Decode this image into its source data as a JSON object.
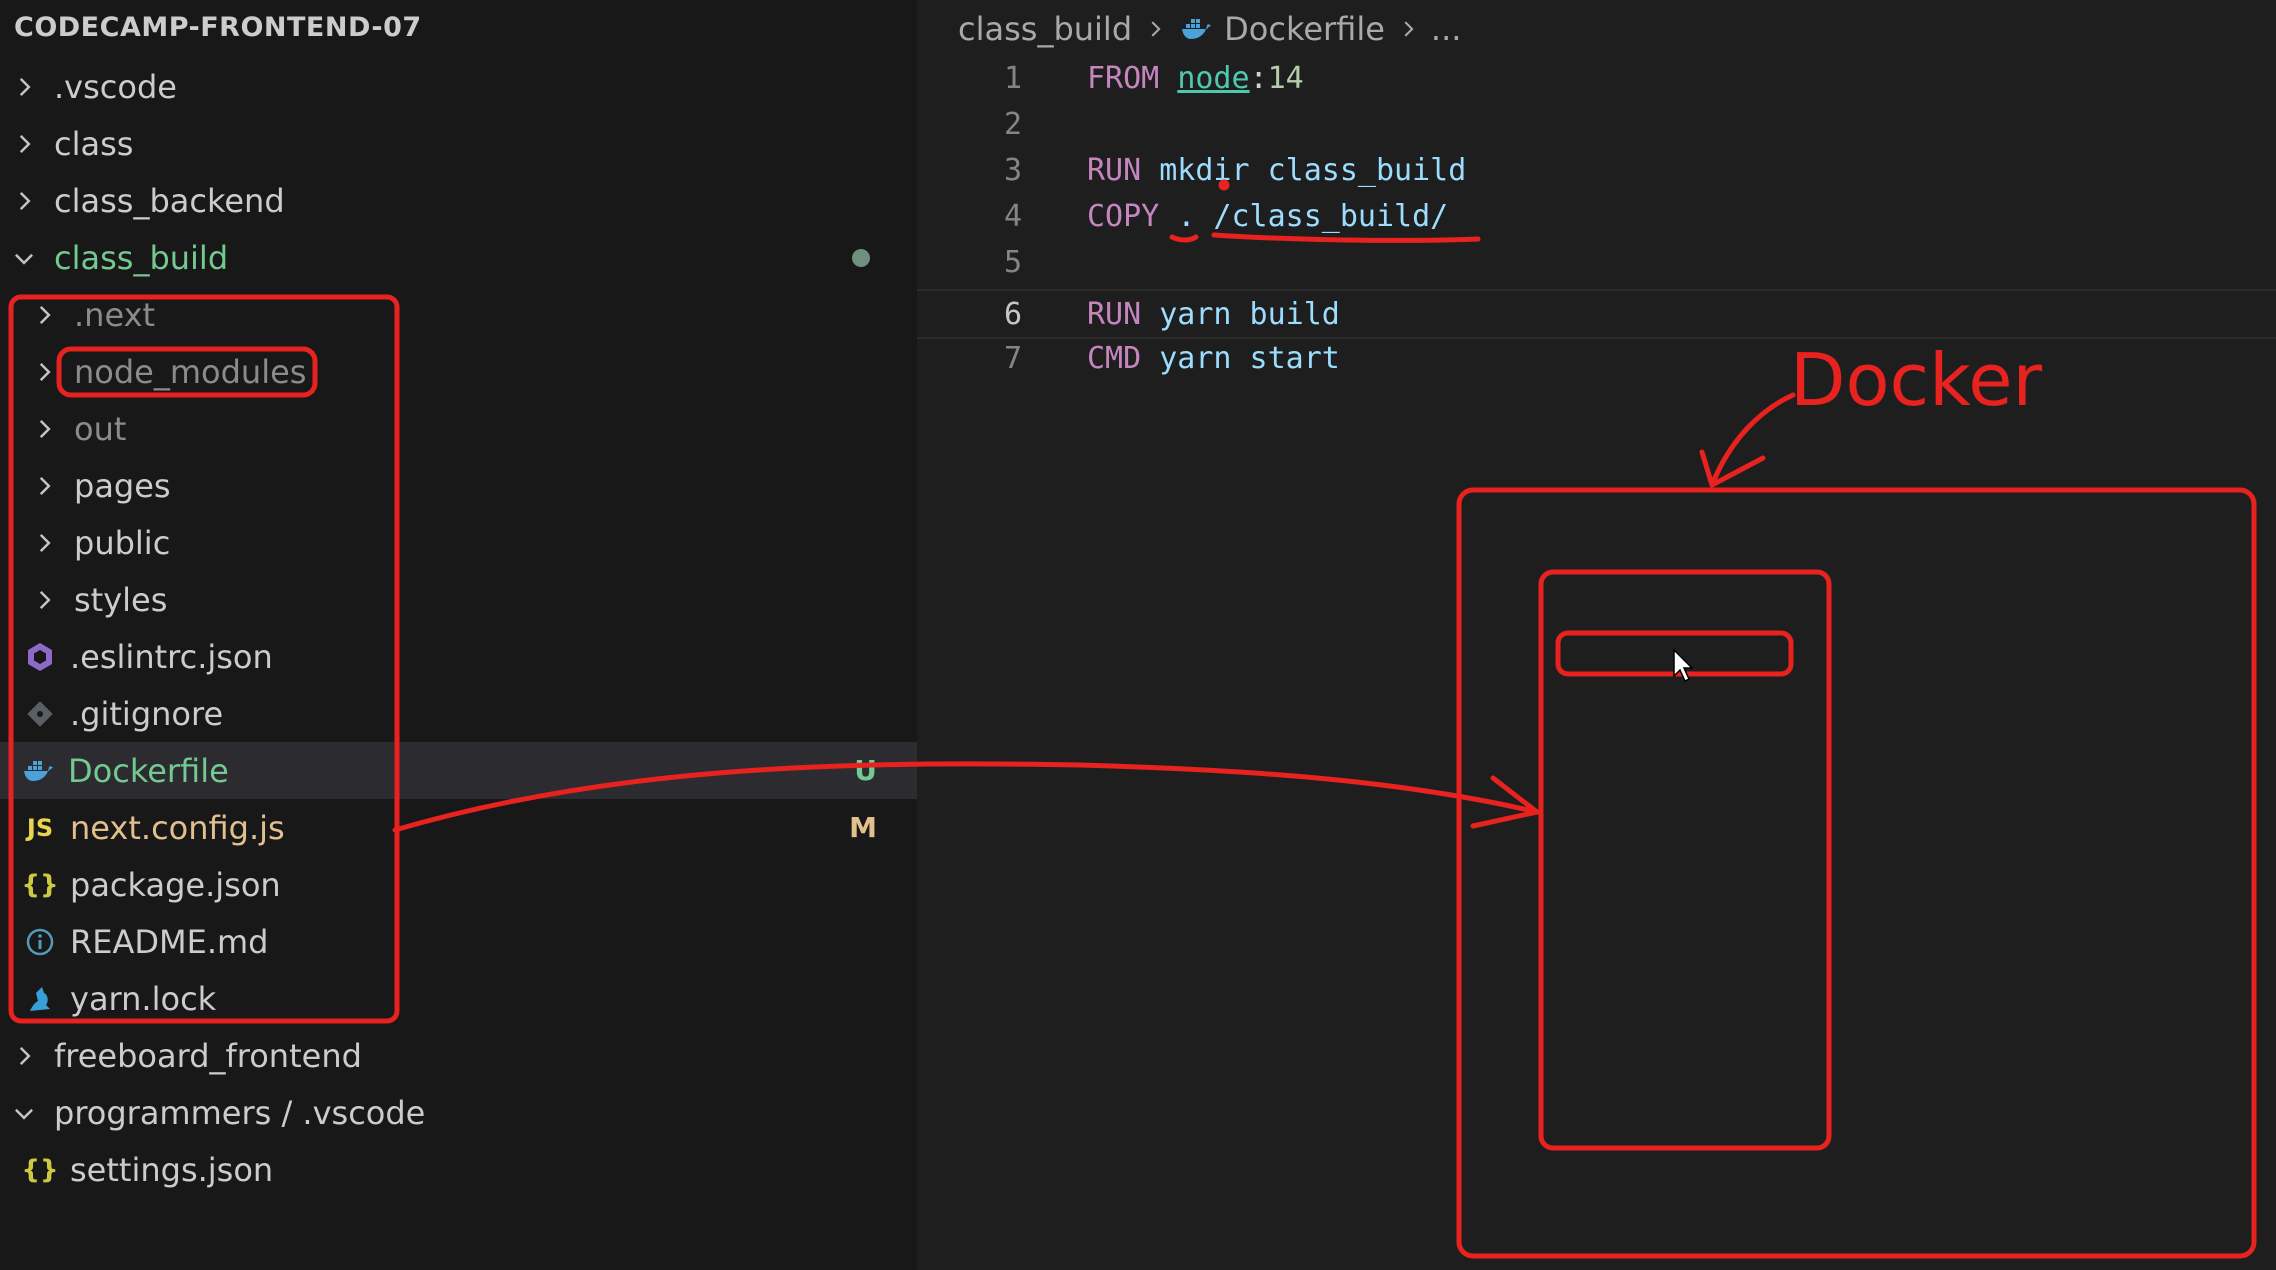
{
  "explorer": {
    "project_title": "CODECAMP-FRONTEND-07",
    "items": [
      {
        "label": ".vscode",
        "kind": "folder",
        "expanded": false,
        "depth": 0
      },
      {
        "label": "class",
        "kind": "folder",
        "expanded": false,
        "depth": 0
      },
      {
        "label": "class_backend",
        "kind": "folder",
        "expanded": false,
        "depth": 0
      },
      {
        "label": "class_build",
        "kind": "folder",
        "expanded": true,
        "depth": 0
      },
      {
        "label": ".next",
        "kind": "folder",
        "expanded": false,
        "depth": 1
      },
      {
        "label": "node_modules",
        "kind": "folder",
        "expanded": false,
        "depth": 1
      },
      {
        "label": "out",
        "kind": "folder",
        "expanded": false,
        "depth": 1
      },
      {
        "label": "pages",
        "kind": "folder",
        "expanded": false,
        "depth": 1
      },
      {
        "label": "public",
        "kind": "folder",
        "expanded": false,
        "depth": 1
      },
      {
        "label": "styles",
        "kind": "folder",
        "expanded": false,
        "depth": 1
      },
      {
        "label": ".eslintrc.json",
        "kind": "file",
        "icon": "eslint-icon",
        "depth": 1
      },
      {
        "label": ".gitignore",
        "kind": "file",
        "icon": "git-icon",
        "depth": 1
      },
      {
        "label": "Dockerfile",
        "kind": "file",
        "icon": "docker-icon",
        "badge": "U",
        "depth": 1
      },
      {
        "label": "next.config.js",
        "kind": "file",
        "icon": "javascript-icon",
        "icon_text": "JS",
        "badge": "M",
        "depth": 1
      },
      {
        "label": "package.json",
        "kind": "file",
        "icon": "json-icon",
        "icon_text": "{}",
        "depth": 1
      },
      {
        "label": "README.md",
        "kind": "file",
        "icon": "info-icon",
        "depth": 1
      },
      {
        "label": "yarn.lock",
        "kind": "file",
        "icon": "yarn-icon",
        "depth": 1
      },
      {
        "label": "freeboard_frontend",
        "kind": "folder",
        "expanded": false,
        "depth": 0
      },
      {
        "label": "programmers / .vscode",
        "kind": "folder",
        "expanded": true,
        "depth": 0
      },
      {
        "label": "settings.json",
        "kind": "file",
        "icon": "json-icon",
        "icon_text": "{}",
        "depth": 1
      }
    ]
  },
  "breadcrumb": {
    "folder": "class_build",
    "file": "Dockerfile",
    "more": "..."
  },
  "editor": {
    "active_line": "6",
    "lines": [
      {
        "num": "1",
        "kw": "FROM",
        "tokens": [
          {
            "t": "node",
            "c": "img"
          },
          {
            "t": ":",
            "c": "white"
          },
          {
            "t": "14",
            "c": "num"
          }
        ]
      },
      {
        "num": "2",
        "kw": "",
        "tokens": []
      },
      {
        "num": "3",
        "kw": "RUN",
        "tokens": [
          {
            "t": "mkdir class_build",
            "c": "plain"
          }
        ]
      },
      {
        "num": "4",
        "kw": "COPY",
        "tokens": [
          {
            "t": ". /class_build/",
            "c": "plain"
          }
        ]
      },
      {
        "num": "5",
        "kw": "",
        "tokens": []
      },
      {
        "num": "6",
        "kw": "RUN",
        "tokens": [
          {
            "t": "yarn build",
            "c": "plain"
          }
        ]
      },
      {
        "num": "7",
        "kw": "CMD",
        "tokens": [
          {
            "t": "yarn start",
            "c": "plain"
          }
        ]
      }
    ]
  },
  "annotation": {
    "label": "Docker",
    "color": "#e8221f"
  },
  "colors": {
    "sidebar_bg": "#181818",
    "editor_bg": "#1e1e1e",
    "selected_row": "#2b2b30",
    "untracked": "#73c991",
    "modified": "#e2c08d"
  }
}
